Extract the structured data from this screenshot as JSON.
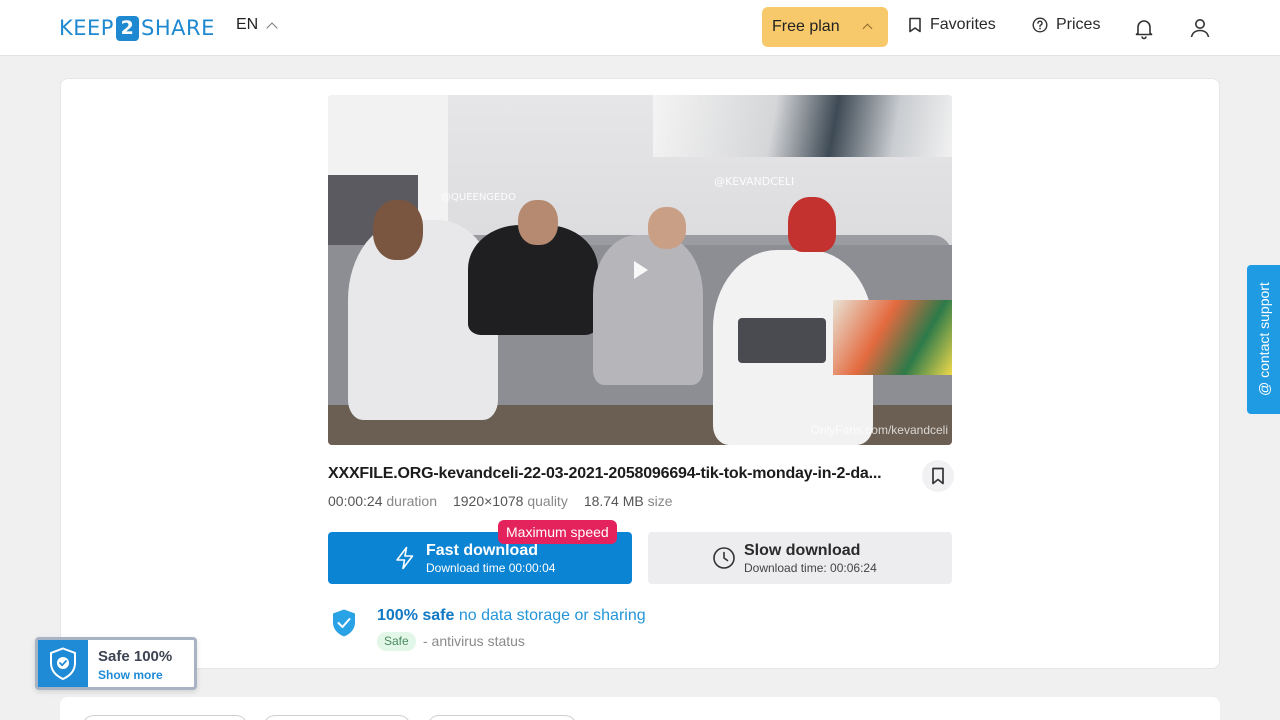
{
  "header": {
    "logo_left": "KEEP",
    "logo_mid": "2",
    "logo_right": "SHARE",
    "lang": "EN",
    "plan_label": "Free plan",
    "favorites_label": "Favorites",
    "prices_label": "Prices"
  },
  "video": {
    "tag_1": "@QUEENGEDO",
    "tag_2": "@KEVANDCELI",
    "watermark": "OnlyFans.com/kevandceli"
  },
  "file": {
    "title": "XXXFILE.ORG-kevandceli-22-03-2021-2058096694-tik-tok-monday-in-2-da...",
    "duration_value": "00:00:24",
    "duration_label": "duration",
    "quality_value": "1920×1078",
    "quality_label": "quality",
    "size_value": "18.74 MB",
    "size_label": "size"
  },
  "download": {
    "max_badge": "Maximum speed",
    "fast_label": "Fast download",
    "fast_time": "Download time 00:00:04",
    "slow_label": "Slow download",
    "slow_time": "Download time: 00:06:24"
  },
  "safety": {
    "strong": "100% safe",
    "rest": "no data storage or sharing",
    "chip": "Safe",
    "status": "- antivirus status"
  },
  "safe_widget": {
    "title": "Safe 100%",
    "link": "Show more"
  },
  "support": {
    "label": "@ contact support"
  },
  "colors": {
    "brand": "#1e88d1",
    "plan": "#f8c96b",
    "fast": "#0b84d4",
    "badge": "#e4225c"
  }
}
